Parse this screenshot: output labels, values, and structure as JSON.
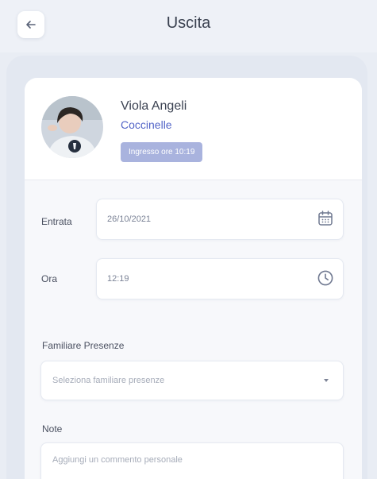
{
  "header": {
    "title": "Uscita",
    "back_icon": "arrow-left-icon"
  },
  "child": {
    "name": "Viola Angeli",
    "group": "Coccinelle",
    "entry_badge": "Ingresso ore 10:19"
  },
  "form": {
    "entry_date": {
      "label": "Entrata",
      "value": "26/10/2021",
      "icon": "calendar-icon"
    },
    "time": {
      "label": "Ora",
      "value": "12:19",
      "icon": "clock-icon"
    },
    "family_member": {
      "label": "Familiare Presenze",
      "placeholder": "Seleziona familiare presenze",
      "icon": "chevron-down-icon"
    },
    "note": {
      "label": "Note",
      "placeholder": "Aggiungi un commento personale"
    }
  },
  "colors": {
    "accent": "#5466c8",
    "badge": "#a9b3de",
    "background": "#e9edf4",
    "card": "#f7f8fb"
  }
}
